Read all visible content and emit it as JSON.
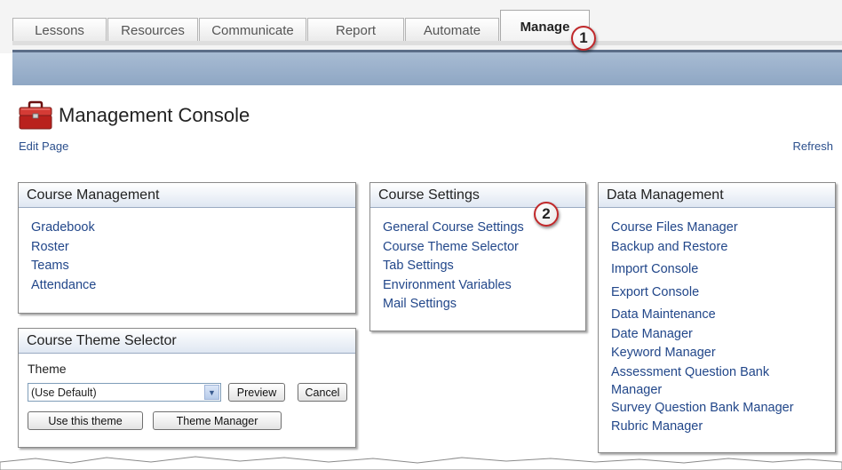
{
  "tabs": [
    {
      "label": "Lessons",
      "active": false
    },
    {
      "label": "Resources",
      "active": false
    },
    {
      "label": "Communicate",
      "active": false
    },
    {
      "label": "Report",
      "active": false
    },
    {
      "label": "Automate",
      "active": false
    },
    {
      "label": "Manage",
      "active": true
    }
  ],
  "callouts": {
    "one": "1",
    "two": "2"
  },
  "page": {
    "title": "Management Console",
    "edit_link": "Edit Page",
    "refresh_link": "Refresh",
    "icon": "toolbox-icon"
  },
  "course_management": {
    "title": "Course Management",
    "items": [
      "Gradebook",
      "Roster",
      "Teams",
      "Attendance"
    ]
  },
  "course_settings": {
    "title": "Course Settings",
    "items": [
      "General Course Settings",
      "Course Theme Selector",
      "Tab Settings",
      "Environment Variables",
      "Mail Settings"
    ]
  },
  "data_management": {
    "title": "Data Management",
    "items": [
      "Course Files Manager",
      "Backup and Restore",
      "Import Console",
      "Export Console",
      "Data Maintenance",
      "Date Manager",
      "Keyword Manager",
      "Assessment Question Bank",
      "Manager",
      "Survey Question Bank Manager",
      "Rubric Manager"
    ]
  },
  "theme_selector": {
    "title": "Course Theme Selector",
    "theme_label": "Theme",
    "selected": "(Use Default)",
    "preview": "Preview",
    "cancel": "Cancel",
    "use_theme": "Use this theme",
    "theme_manager": "Theme Manager"
  },
  "colors": {
    "link": "#22478a",
    "bar": "#8fa7c4",
    "callout_ring": "#c0282a"
  }
}
